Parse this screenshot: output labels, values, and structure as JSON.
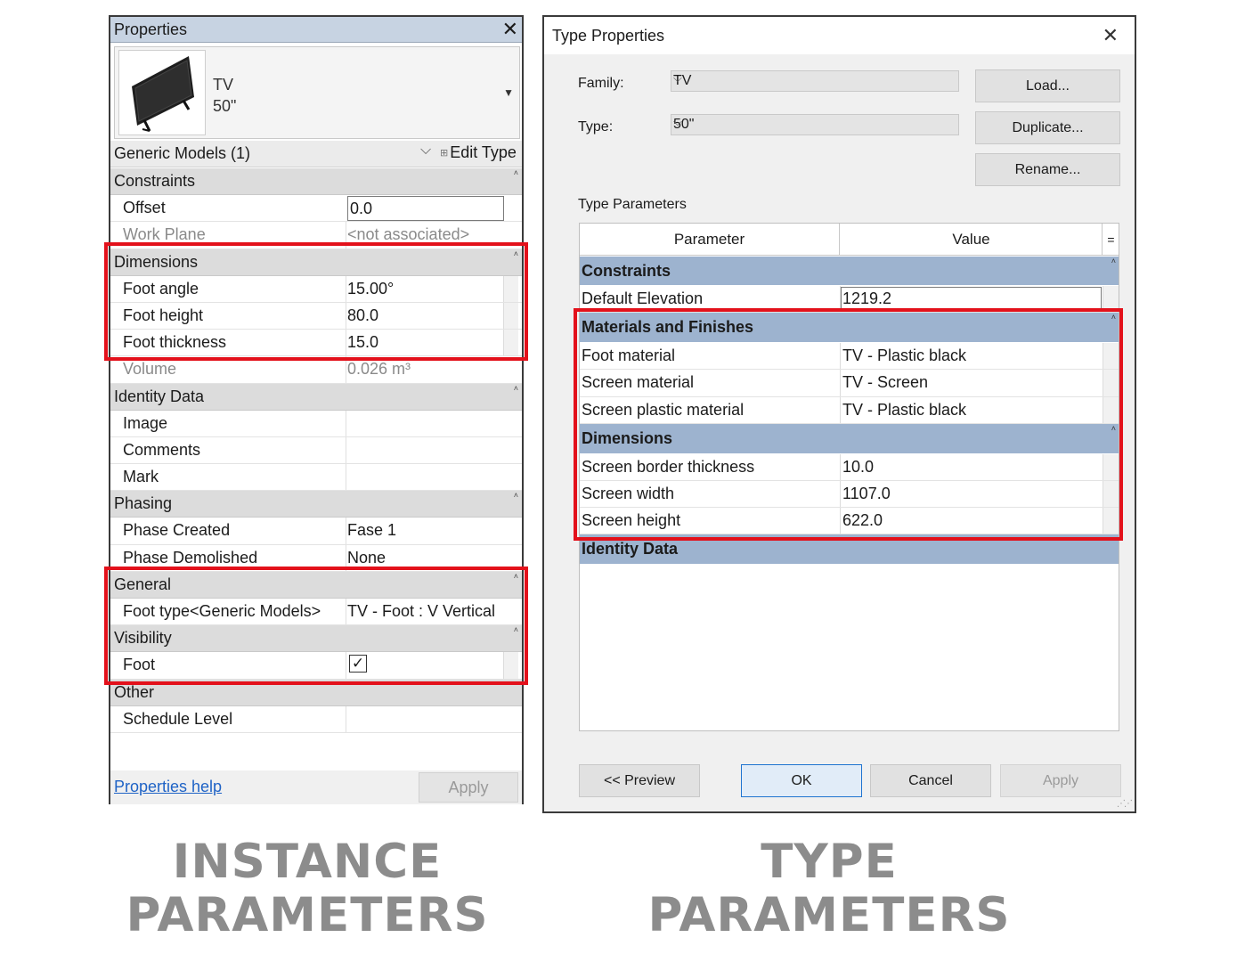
{
  "properties": {
    "title": "Properties",
    "close_glyph": "✕",
    "type_name": "TV",
    "type_size": "50\"",
    "family_selector": "Generic Models (1)",
    "edit_type": "Edit Type",
    "help_link": "Properties help",
    "apply": "Apply",
    "groups": {
      "constraints": "Constraints",
      "dimensions": "Dimensions",
      "identity": "Identity Data",
      "phasing": "Phasing",
      "general": "General",
      "visibility": "Visibility",
      "other": "Other"
    },
    "rows": {
      "offset": {
        "name": "Offset",
        "value": "0.0"
      },
      "work_plane": {
        "name": "Work Plane",
        "value": "<not associated>"
      },
      "foot_angle": {
        "name": "Foot angle",
        "value": "15.00°"
      },
      "foot_height": {
        "name": "Foot height",
        "value": "80.0"
      },
      "foot_thickness": {
        "name": "Foot thickness",
        "value": "15.0"
      },
      "volume": {
        "name": "Volume",
        "value": "0.026 m³"
      },
      "image": {
        "name": "Image",
        "value": ""
      },
      "comments": {
        "name": "Comments",
        "value": ""
      },
      "mark": {
        "name": "Mark",
        "value": ""
      },
      "phase_created": {
        "name": "Phase Created",
        "value": "Fase 1"
      },
      "phase_demolished": {
        "name": "Phase Demolished",
        "value": "None"
      },
      "foot_type": {
        "name": "Foot type<Generic Models>",
        "value": "TV - Foot : V Vertical"
      },
      "foot": {
        "name": "Foot",
        "checked": true
      },
      "schedule_level": {
        "name": "Schedule Level",
        "value": ""
      }
    }
  },
  "type_properties": {
    "title": "Type Properties",
    "close_glyph": "✕",
    "family_label": "Family:",
    "family_value": "TV",
    "type_label": "Type:",
    "type_value": "50\"",
    "load_button": "Load...",
    "duplicate_button": "Duplicate...",
    "rename_button": "Rename...",
    "section_label": "Type Parameters",
    "col_parameter": "Parameter",
    "col_value": "Value",
    "col_extra": "=",
    "groups": {
      "constraints": "Constraints",
      "materials": "Materials and Finishes",
      "dimensions": "Dimensions",
      "identity": "Identity Data"
    },
    "rows": {
      "default_elevation": {
        "name": "Default Elevation",
        "value": "1219.2"
      },
      "foot_material": {
        "name": "Foot material",
        "value": "TV - Plastic black"
      },
      "screen_material": {
        "name": "Screen material",
        "value": "TV - Screen"
      },
      "screen_plastic_material": {
        "name": "Screen plastic material",
        "value": "TV - Plastic black"
      },
      "screen_border_thickness": {
        "name": "Screen border thickness",
        "value": "10.0"
      },
      "screen_width": {
        "name": "Screen width",
        "value": "1107.0"
      },
      "screen_height": {
        "name": "Screen height",
        "value": "622.0"
      }
    },
    "preview_button": "<< Preview",
    "ok_button": "OK",
    "cancel_button": "Cancel",
    "apply_button": "Apply"
  },
  "captions": {
    "instance_line1": "INSTANCE",
    "instance_line2": "PARAMETERS",
    "type_line1": "TYPE",
    "type_line2": "PARAMETERS"
  },
  "colors": {
    "highlight": "#e3111b",
    "group_header_type": "#9db3cf",
    "group_header_instance": "#dcdcdc",
    "caption": "#8c8c8c",
    "link": "#1f63c6"
  }
}
